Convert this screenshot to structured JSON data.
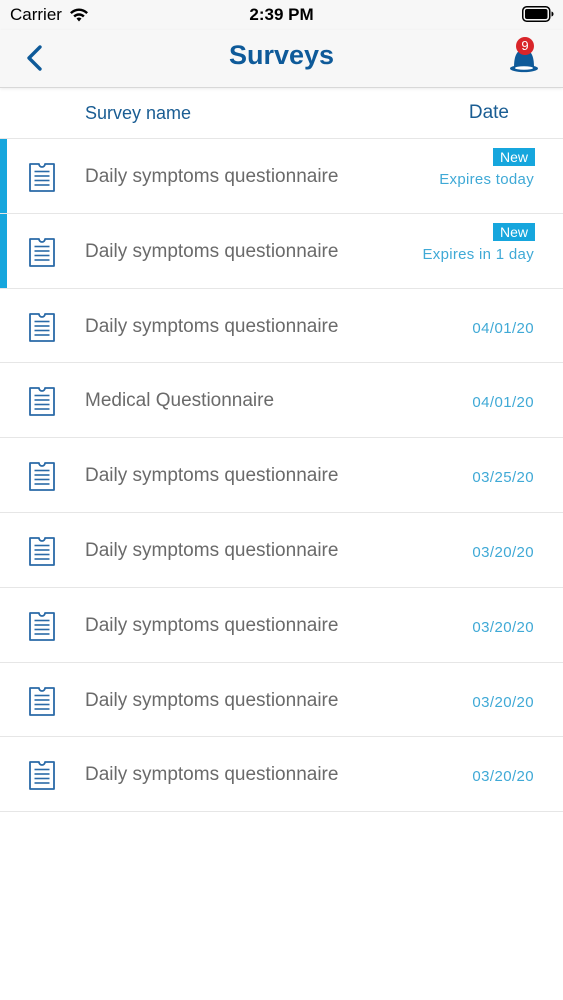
{
  "status_bar": {
    "carrier": "Carrier",
    "time": "2:39 PM",
    "wifi_icon": "wifi-icon",
    "battery_icon": "battery-icon"
  },
  "nav": {
    "title": "Surveys",
    "back_icon": "chevron-left-icon",
    "bell_icon": "bell-icon",
    "badge_count": "9"
  },
  "table_header": {
    "name_label": "Survey name",
    "date_label": "Date"
  },
  "colors": {
    "primary": "#0e5a99",
    "accent": "#16a6dd",
    "badge_red": "#d9252a",
    "text_gray": "#6a6a6a"
  },
  "surveys": [
    {
      "name": "Daily symptoms questionnaire",
      "is_new": true,
      "badge": "New",
      "expires": "Expires today",
      "date": ""
    },
    {
      "name": "Daily symptoms questionnaire",
      "is_new": true,
      "badge": "New",
      "expires": "Expires in 1 day",
      "date": ""
    },
    {
      "name": "Daily symptoms questionnaire",
      "is_new": false,
      "date": "04/01/20"
    },
    {
      "name": "Medical Questionnaire",
      "is_new": false,
      "date": "04/01/20"
    },
    {
      "name": "Daily symptoms questionnaire",
      "is_new": false,
      "date": "03/25/20"
    },
    {
      "name": "Daily symptoms questionnaire",
      "is_new": false,
      "date": "03/20/20"
    },
    {
      "name": "Daily symptoms questionnaire",
      "is_new": false,
      "date": "03/20/20"
    },
    {
      "name": "Daily symptoms questionnaire",
      "is_new": false,
      "date": "03/20/20"
    },
    {
      "name": "Daily symptoms questionnaire",
      "is_new": false,
      "date": "03/20/20"
    }
  ]
}
